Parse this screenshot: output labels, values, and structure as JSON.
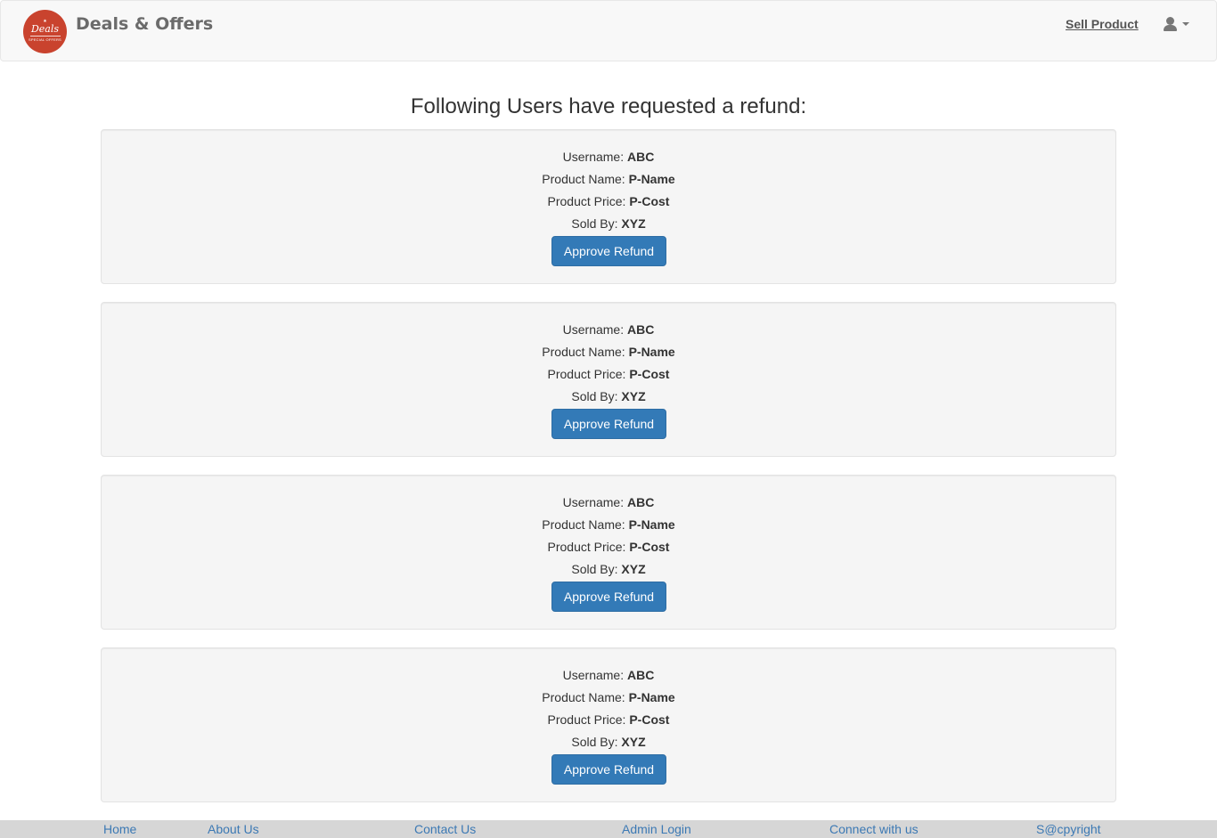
{
  "brand": {
    "title": "Deals & Offers",
    "logo_script": "Deals",
    "logo_small": "SPECIAL OFFERS"
  },
  "nav": {
    "sell_product": "Sell Product",
    "user_icon": "user-icon"
  },
  "page_title": "Following Users have requested a refund:",
  "labels": {
    "username": "Username:",
    "product_name": "Product Name:",
    "product_price": "Product Price:",
    "sold_by": "Sold By:"
  },
  "refunds": [
    {
      "username": "ABC",
      "product_name": "P-Name",
      "product_price": "P-Cost",
      "sold_by": "XYZ",
      "button": "Approve Refund"
    },
    {
      "username": "ABC",
      "product_name": "P-Name",
      "product_price": "P-Cost",
      "sold_by": "XYZ",
      "button": "Approve Refund"
    },
    {
      "username": "ABC",
      "product_name": "P-Name",
      "product_price": "P-Cost",
      "sold_by": "XYZ",
      "button": "Approve Refund"
    },
    {
      "username": "ABC",
      "product_name": "P-Name",
      "product_price": "P-Cost",
      "sold_by": "XYZ",
      "button": "Approve Refund"
    }
  ],
  "footer": {
    "home": "Home",
    "about": "About Us",
    "contact": "Contact Us",
    "admin": "Admin Login",
    "connect": "Connect with us",
    "copyright": "S@cpyright"
  },
  "colors": {
    "primary": "#337ab7",
    "logo": "#c9432e",
    "link": "#3c79b4"
  }
}
